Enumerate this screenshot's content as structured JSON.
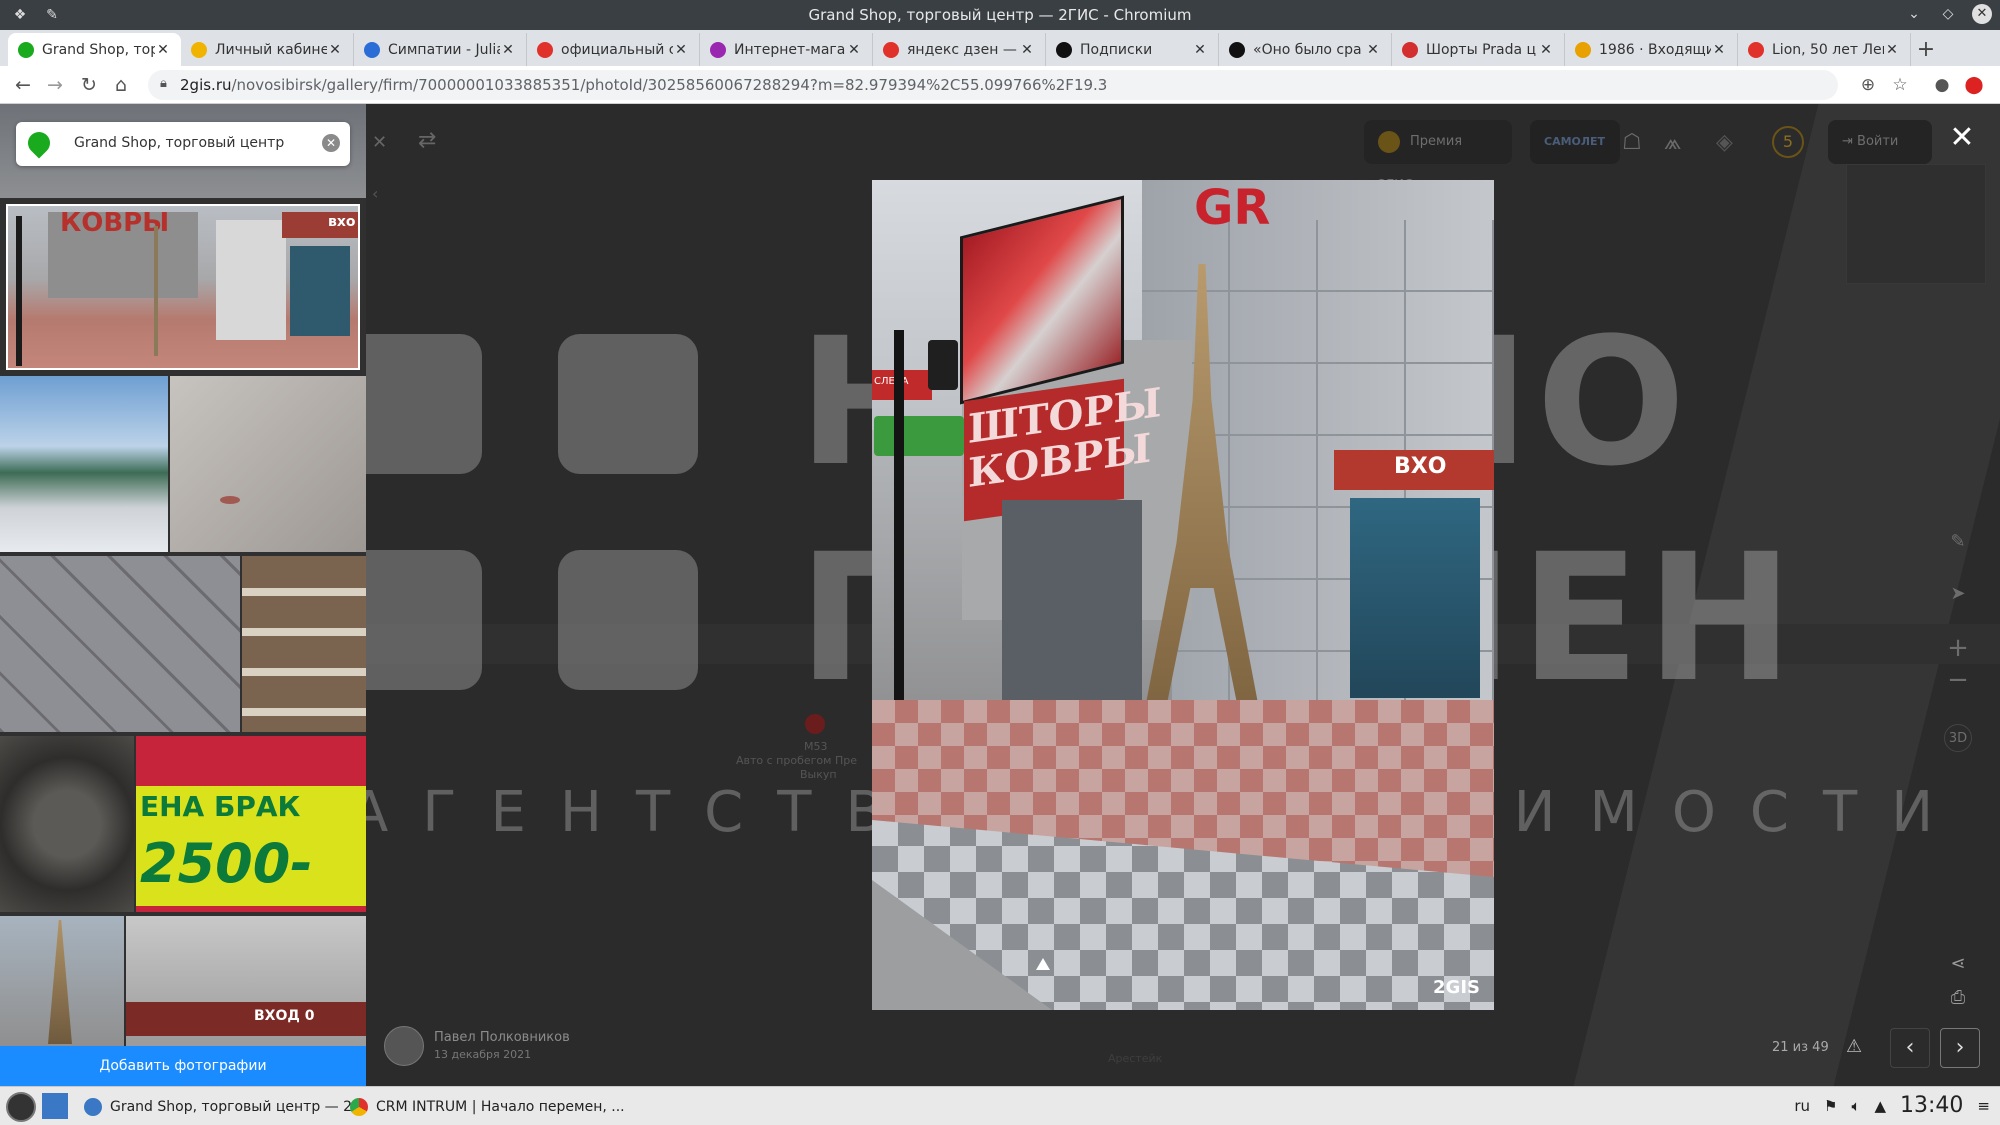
{
  "window": {
    "title": "Grand Shop, торговый центр — 2ГИС - Chromium"
  },
  "tabs": [
    {
      "label": "Grand Shop, тор",
      "color": "#19aa1e",
      "active": true
    },
    {
      "label": "Личный кабинет",
      "color": "#f0b400"
    },
    {
      "label": "Симпатии - Julia",
      "color": "#2a6dd6"
    },
    {
      "label": "официальный с",
      "color": "#e0312b"
    },
    {
      "label": "Интернет-магаз",
      "color": "#9a27b0"
    },
    {
      "label": "яндекс дзен — Я",
      "color": "#e0312b"
    },
    {
      "label": "Подписки",
      "color": "#111111"
    },
    {
      "label": "«Оно было сра",
      "color": "#111111"
    },
    {
      "label": "Шорты Prada ц",
      "color": "#d32f2f"
    },
    {
      "label": "1986 · Входящие",
      "color": "#e8a100"
    },
    {
      "label": "Lion, 50 лет Лев",
      "color": "#e0312b"
    }
  ],
  "addressbar": {
    "host": "2gis.ru",
    "path": "/novosibirsk/gallery/firm/70000001033885351/photoId/30258560067288294?m=82.979394%2C55.099766%2F19.3"
  },
  "gallery": {
    "search_label": "Grand Shop, торговый центр",
    "add_photo_label": "Добавить фотографии",
    "thumb_texts": {
      "kovry": "КОВРЫ",
      "vkh": "вхо",
      "ena_brak": "ЕНА БРАК",
      "price": "2500-",
      "vkhod": "ВХОД 0"
    }
  },
  "watermark": {
    "line1": "НАЧАЛО",
    "line2": "ПЕРЕМЕН",
    "subtitle": "АГЕНТСТВО НЕДВИЖИМОСТИ"
  },
  "map_labels": {
    "poi_number": "М53",
    "poi_name": "Авто с пробегом Пре",
    "poi_sub": "Выкуп",
    "bottom_label": "Арестейк"
  },
  "topbar": {
    "premium_label": "Премия 2ГИС",
    "samolet_label": "САМОЛЕТ",
    "login_label": "Войти",
    "badge_number": "5"
  },
  "photo": {
    "sign_main": "ШТОРЫ КОВРЫ",
    "sign_top": "GR",
    "sign_entrance": "ВХО",
    "sign_left": "СЛЕБА",
    "brand": "2GIS"
  },
  "author": {
    "name": "Павел Полковников",
    "date": "13 декабря 2021"
  },
  "pager": {
    "counter": "21 из 49"
  },
  "taskbar": {
    "tasks": [
      {
        "label": "Grand Shop, торговый центр — 2...",
        "color": "#3a77c4"
      },
      {
        "label": "CRM INTRUM | Начало перемен, ...",
        "color": "#e0312b"
      }
    ],
    "lang": "ru",
    "clock": "13:40"
  }
}
